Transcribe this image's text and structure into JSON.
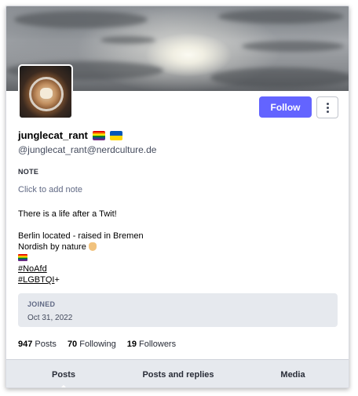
{
  "profile": {
    "display_name": "junglecat_rant",
    "name_emoji": [
      "rainbow-flag",
      "ukraine-flag"
    ],
    "handle": "@junglecat_rant@nerdculture.de",
    "follow_label": "Follow",
    "menu_icon": "vertical-ellipsis-icon"
  },
  "note": {
    "label": "NOTE",
    "placeholder": "Click to add note"
  },
  "bio": {
    "line1": "There is a life after a Twit!",
    "line2": "Berlin located - raised in Bremen",
    "line3": "Nordish by nature",
    "line3_emoji": "vulcan-salute",
    "line4_emoji": "rainbow-flag",
    "hashtag1": "#NoAfd",
    "hashtag2": "#LGBTQI",
    "hashtag2_suffix": "+"
  },
  "joined": {
    "label": "JOINED",
    "date": "Oct 31, 2022"
  },
  "stats": {
    "posts_count": "947",
    "posts_label": "Posts",
    "following_count": "70",
    "following_label": "Following",
    "followers_count": "19",
    "followers_label": "Followers"
  },
  "tabs": [
    {
      "label": "Posts",
      "active": true
    },
    {
      "label": "Posts and replies",
      "active": false
    },
    {
      "label": "Media",
      "active": false
    }
  ],
  "colors": {
    "accent": "#6364ff",
    "panel": "#e6e9ee"
  }
}
